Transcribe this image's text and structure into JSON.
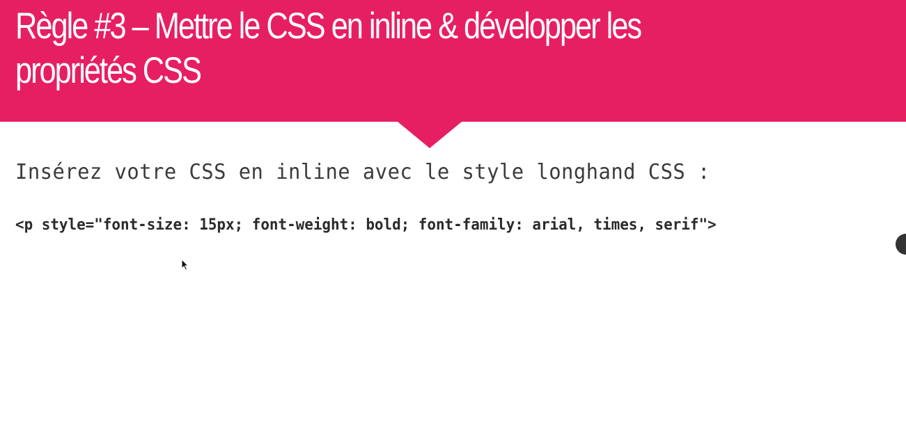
{
  "header": {
    "title": "Règle #3 – Mettre le CSS en inline & développer les propriétés CSS",
    "accent_color": "#e61f63"
  },
  "content": {
    "intro_text": "Insérez votre CSS en inline avec le style longhand CSS :",
    "code_sample": "<p style=\"font-size: 15px; font-weight: bold; font-family: arial, times, serif\">"
  },
  "icons": {
    "cursor": "mouse-pointer-icon",
    "side_handle": "circle-handle-icon"
  }
}
